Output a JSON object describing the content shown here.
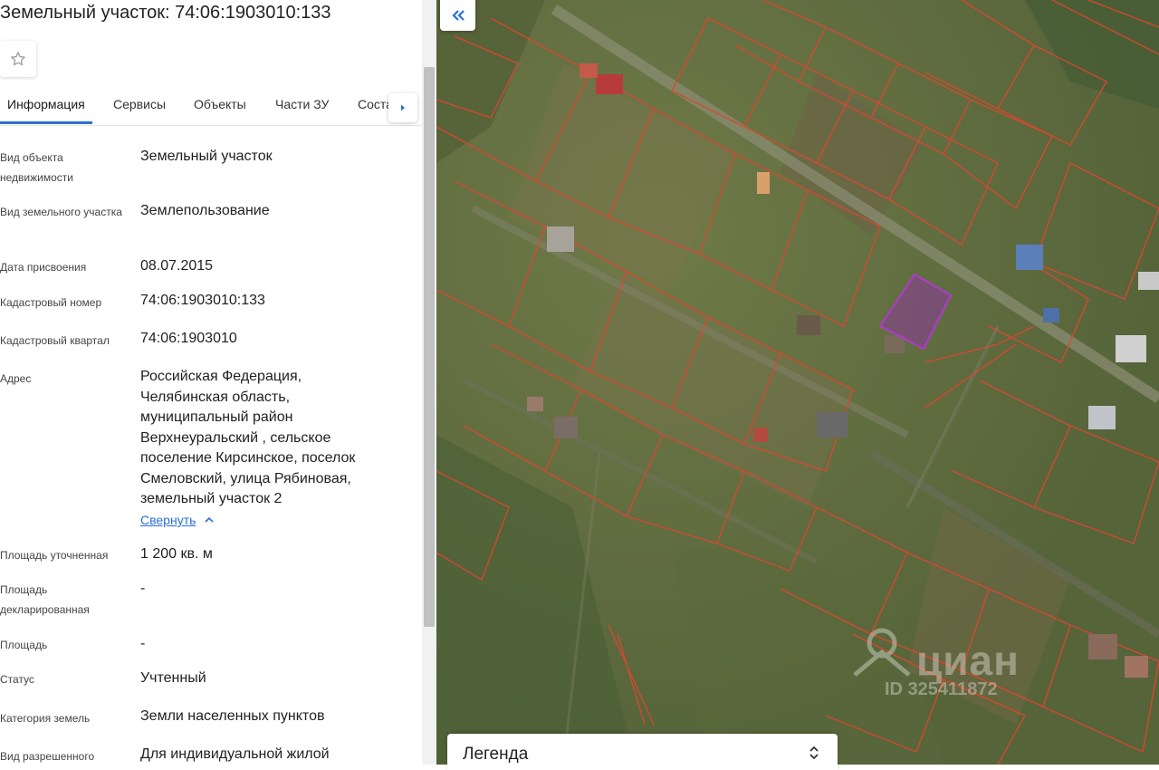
{
  "title": "Земельный участок: 74:06:1903010:133",
  "tabs": [
    {
      "label": "Информация",
      "active": true
    },
    {
      "label": "Сервисы",
      "active": false
    },
    {
      "label": "Объекты",
      "active": false
    },
    {
      "label": "Части ЗУ",
      "active": false
    },
    {
      "label": "Соста",
      "active": false
    }
  ],
  "fields": [
    {
      "label": "Вид объекта недвижимости",
      "value": "Земельный участок"
    },
    {
      "label": "Вид земельного участка",
      "value": "Землепользование"
    },
    {
      "label": "Дата присвоения",
      "value": "08.07.2015"
    },
    {
      "label": "Кадастровый номер",
      "value": "74:06:1903010:133"
    },
    {
      "label": "Кадастровый квартал",
      "value": "74:06:1903010"
    },
    {
      "label": "Адрес",
      "value": "Российская Федерация, Челябинская область, муниципальный район Верхнеуральский , сельское поселение Кирсинское, поселок Смеловский, улица Рябиновая, земельный участок 2"
    },
    {
      "label": "Площадь уточненная",
      "value": "1 200 кв. м"
    },
    {
      "label": "Площадь декларированная",
      "value": "-"
    },
    {
      "label": "Площадь",
      "value": "-"
    },
    {
      "label": "Статус",
      "value": "Учтенный"
    },
    {
      "label": "Категория земель",
      "value": "Земли населенных пунктов"
    },
    {
      "label": "Вид разрешенного",
      "value": "Для индивидуальной жилой"
    }
  ],
  "collapse_label": "Свернуть",
  "map": {
    "legend_title": "Легенда",
    "watermark": "циан",
    "watermark_id": "ID 325411872"
  },
  "colors": {
    "accent": "#2b6fd6",
    "parcel_border": "#e0452f",
    "selected_parcel": "#a23bb0"
  },
  "icons": [
    "star-icon",
    "chevron-right-icon",
    "chevron-up-icon",
    "double-chevron-left-icon",
    "sort-icon"
  ]
}
